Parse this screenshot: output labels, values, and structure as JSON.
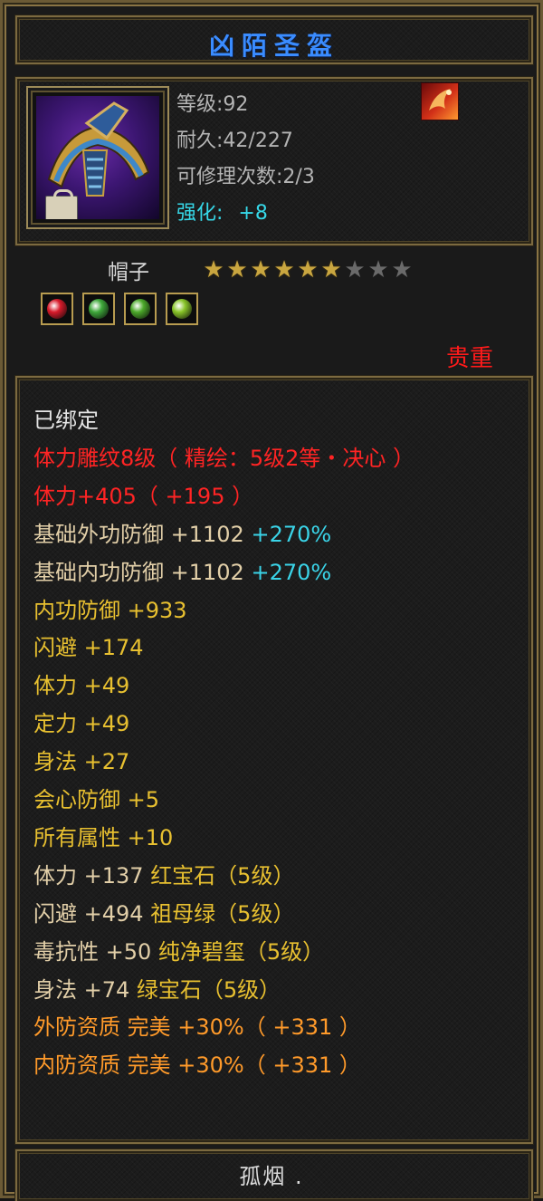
{
  "item": {
    "name": "凶陌圣盔",
    "level_text": "等级:92",
    "durability_text": "耐久:42/227",
    "repair_text": "可修理次数:2/3",
    "enhance_label": "强化:",
    "enhance_value": "+8",
    "type": "帽子",
    "stars_total": 9,
    "stars_filled": 6,
    "rarity": "贵重",
    "colors": {
      "title": "#3a8cff",
      "rarity": "#ff1a1a",
      "star_on": "#c9a640",
      "star_off": "#6a6a6a"
    }
  },
  "gems": [
    {
      "icon": "ruby-gem-icon",
      "color": "#d81a2a"
    },
    {
      "icon": "emerald-gem-icon",
      "color": "#3ea83a"
    },
    {
      "icon": "jade-gem-icon",
      "color": "#4caa2a"
    },
    {
      "icon": "green-jade-gem-icon",
      "color": "#88c428"
    }
  ],
  "stats": [
    {
      "segments": [
        {
          "text": "已绑定",
          "color": "white"
        }
      ]
    },
    {
      "segments": [
        {
          "text": "体力雕纹8级（ 精绘：5级2等・决心 ）",
          "color": "red"
        }
      ]
    },
    {
      "segments": [
        {
          "text": "体力+405（ +195 ）",
          "color": "red"
        }
      ]
    },
    {
      "segments": [
        {
          "text": "基础外功防御 +1102 ",
          "color": "tan"
        },
        {
          "text": "+270%",
          "color": "cyan"
        }
      ]
    },
    {
      "segments": [
        {
          "text": "基础内功防御 +1102 ",
          "color": "tan"
        },
        {
          "text": "+270%",
          "color": "cyan"
        }
      ]
    },
    {
      "segments": [
        {
          "text": "内功防御 +933",
          "color": "gold"
        }
      ]
    },
    {
      "segments": [
        {
          "text": "闪避 +174",
          "color": "gold"
        }
      ]
    },
    {
      "segments": [
        {
          "text": "体力 +49",
          "color": "gold"
        }
      ]
    },
    {
      "segments": [
        {
          "text": "定力 +49",
          "color": "gold"
        }
      ]
    },
    {
      "segments": [
        {
          "text": "身法 +27",
          "color": "gold"
        }
      ]
    },
    {
      "segments": [
        {
          "text": "会心防御 +5",
          "color": "gold"
        }
      ]
    },
    {
      "segments": [
        {
          "text": "所有属性 +10",
          "color": "gold"
        }
      ]
    },
    {
      "segments": [
        {
          "text": "体力 +137 ",
          "color": "tan"
        },
        {
          "text": "红宝石（5级）",
          "color": "gold"
        }
      ]
    },
    {
      "segments": [
        {
          "text": "闪避 +494 ",
          "color": "tan"
        },
        {
          "text": "祖母绿（5级）",
          "color": "gold"
        }
      ]
    },
    {
      "segments": [
        {
          "text": "毒抗性 +50 ",
          "color": "tan"
        },
        {
          "text": "纯净碧玺（5级）",
          "color": "gold"
        }
      ]
    },
    {
      "segments": [
        {
          "text": "身法 +74 ",
          "color": "tan"
        },
        {
          "text": "绿宝石（5级）",
          "color": "gold"
        }
      ]
    },
    {
      "segments": [
        {
          "text": "外防资质 完美 +30%（ +331 ）",
          "color": "orange"
        }
      ]
    },
    {
      "segments": [
        {
          "text": "内防资质 完美 +30%（ +331 ）",
          "color": "orange"
        }
      ]
    }
  ],
  "footer": {
    "owner": "孤烟 ."
  }
}
